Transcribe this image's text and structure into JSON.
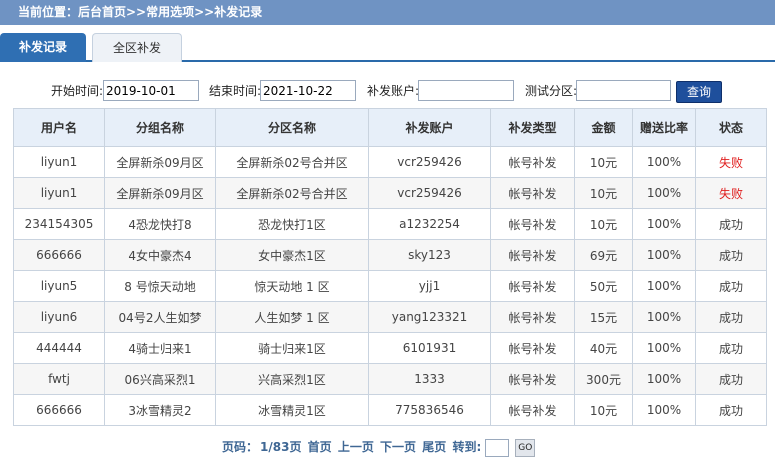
{
  "breadcrumb": "当前位置：后台首页>>常用选项>>补发记录",
  "tabs": [
    {
      "label": "补发记录",
      "active": true
    },
    {
      "label": "全区补发",
      "active": false
    }
  ],
  "filters": {
    "start_label": "开始时间:",
    "start_value": "2019-10-01",
    "end_label": "结束时间:",
    "end_value": "2021-10-22",
    "account_label": "补发账户:",
    "account_value": "",
    "zone_label": "测试分区:",
    "zone_value": "",
    "query_label": "查询"
  },
  "table": {
    "headers": [
      "用户名",
      "分组名称",
      "分区名称",
      "补发账户",
      "补发类型",
      "金额",
      "赠送比率",
      "状态"
    ],
    "rows": [
      [
        "liyun1",
        "全屏新杀09月区",
        "全屏新杀02号合并区",
        "vcr259426",
        "帐号补发",
        "10元",
        "100%",
        "失败"
      ],
      [
        "liyun1",
        "全屏新杀09月区",
        "全屏新杀02号合并区",
        "vcr259426",
        "帐号补发",
        "10元",
        "100%",
        "失败"
      ],
      [
        "234154305",
        "4恐龙快打8",
        "恐龙快打1区",
        "a1232254",
        "帐号补发",
        "10元",
        "100%",
        "成功"
      ],
      [
        "666666",
        "4女中豪杰4",
        "女中豪杰1区",
        "sky123",
        "帐号补发",
        "69元",
        "100%",
        "成功"
      ],
      [
        "liyun5",
        "8 号惊天动地",
        "惊天动地 1 区",
        "yjj1",
        "帐号补发",
        "50元",
        "100%",
        "成功"
      ],
      [
        "liyun6",
        "04号2人生如梦",
        "人生如梦 1 区",
        "yang123321",
        "帐号补发",
        "15元",
        "100%",
        "成功"
      ],
      [
        "444444",
        "4骑士归来1",
        "骑士归来1区",
        "6101931",
        "帐号补发",
        "40元",
        "100%",
        "成功"
      ],
      [
        "fwtj",
        "06兴高采烈1",
        "兴高采烈1区",
        "1333",
        "帐号补发",
        "300元",
        "100%",
        "成功"
      ],
      [
        "666666",
        "3冰雪精灵2",
        "冰雪精灵1区",
        "775836546",
        "帐号补发",
        "10元",
        "100%",
        "成功"
      ]
    ]
  },
  "pager": {
    "page_label": "页码：",
    "page_info": "1/83页",
    "first": "首页",
    "prev": "上一页",
    "next": "下一页",
    "last": "尾页",
    "goto_label": "转到:",
    "go_label": "GO"
  },
  "colors": {
    "topbar": "#6f93c3",
    "active_tab": "#2f6fb3",
    "header_bg": "#e7eff9",
    "fail_text": "#e02020"
  }
}
